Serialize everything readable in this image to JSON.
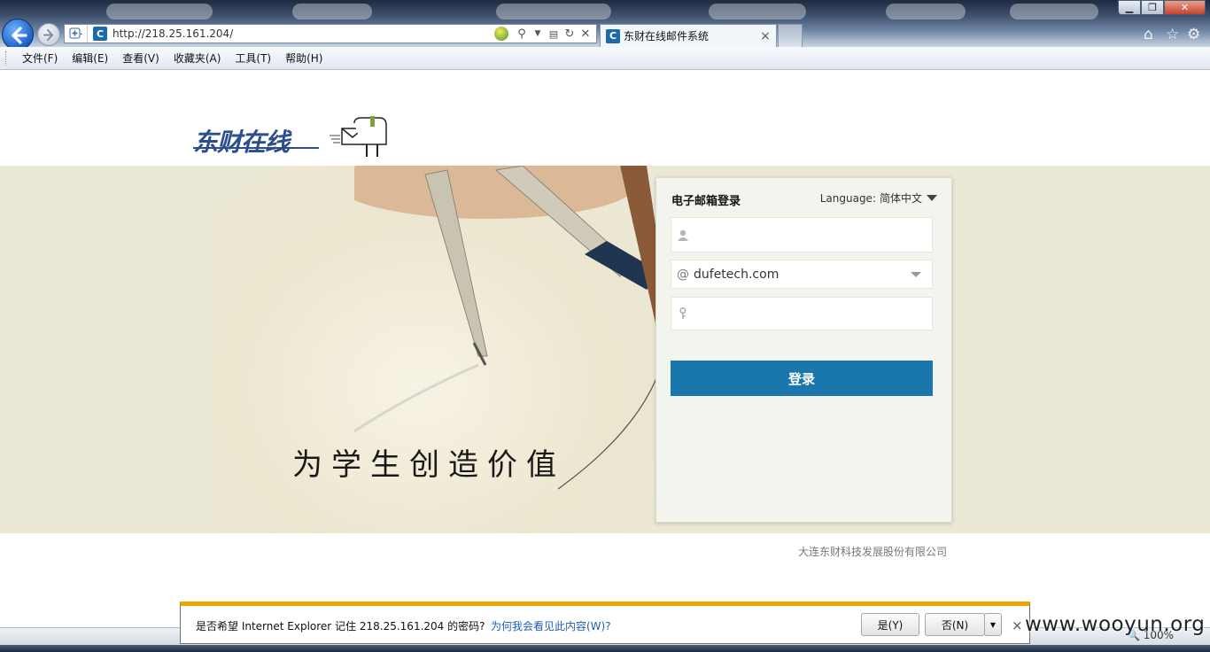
{
  "browser": {
    "url": "http://218.25.161.204/",
    "tab_title": "东财在线邮件系统",
    "tab_close": "×",
    "window_controls": {
      "minimize": "▁",
      "maximize": "❐",
      "close": "✕"
    },
    "icons": {
      "back": "back-arrow-icon",
      "forward": "forward-arrow-icon",
      "home": "home-icon",
      "favorites": "star-icon",
      "tools": "gear-icon"
    }
  },
  "menu": {
    "items": [
      "文件(F)",
      "编辑(E)",
      "查看(V)",
      "收藏夹(A)",
      "工具(T)",
      "帮助(H)"
    ]
  },
  "page": {
    "logo_text": "东财在线",
    "slogan": "为学生创造价值",
    "company": "大连东财科技发展股份有限公司"
  },
  "login": {
    "title": "电子邮箱登录",
    "language_label": "Language:",
    "language_value": "简体中文",
    "username_value": "",
    "domain_at": "@",
    "domain": "dufetech.com",
    "password_value": "",
    "submit": "登录"
  },
  "notification": {
    "message": "是否希望 Internet Explorer 记住 218.25.161.204 的密码?",
    "link": "为何我会看见此内容(W)?",
    "yes": "是(Y)",
    "no": "否(N)",
    "close": "×"
  },
  "status": {
    "zoom": "100%"
  },
  "watermark": "www.wooyun.org",
  "colors": {
    "accent": "#1a77ac",
    "banner_bg": "#ebe8d6",
    "notify_border": "#f0a400",
    "logo": "#2c4f8c"
  }
}
